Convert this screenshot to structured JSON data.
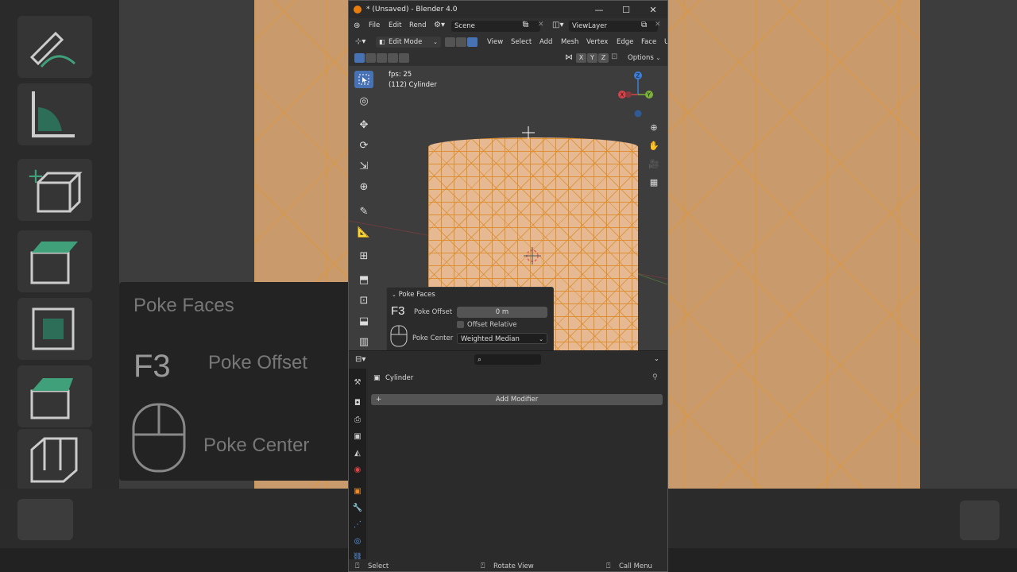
{
  "window": {
    "title": "* (Unsaved) - Blender 4.0",
    "controls": {
      "minimize": "—",
      "maximize": "☐",
      "close": "✕"
    }
  },
  "menubar": {
    "items": [
      "File",
      "Edit",
      "Rend"
    ],
    "scene": "Scene",
    "view_layer": "ViewLayer"
  },
  "viewport_header": {
    "mode": "Edit Mode",
    "menus": [
      "View",
      "Select",
      "Add",
      "Mesh",
      "Vertex",
      "Edge",
      "Face",
      "U"
    ],
    "axes": [
      "X",
      "Y",
      "Z"
    ],
    "options": "Options"
  },
  "viewport": {
    "fps": "fps: 25",
    "object": "(112) Cylinder",
    "gizmo": {
      "x": "X",
      "y": "Y",
      "z": "Z"
    }
  },
  "operator_panel": {
    "title": "Poke Faces",
    "hotkey": "F3",
    "offset_label": "Poke Offset",
    "offset_value": "0 m",
    "relative_label": "Offset Relative",
    "center_label": "Poke Center",
    "center_value": "Weighted Median"
  },
  "properties": {
    "object_name": "Cylinder",
    "add_modifier": "Add Modifier",
    "search_placeholder": ""
  },
  "statusbar": {
    "select": "Select",
    "rotate": "Rotate View",
    "call_menu": "Call Menu"
  },
  "background": {
    "panel_title": "Poke Faces",
    "hotkey": "F3",
    "offset_label": "Poke Offset",
    "center_label": "Poke Center"
  },
  "colors": {
    "accent": "#4772b3",
    "mesh_face": "#e6b993",
    "mesh_edge": "#e08c28",
    "blender_orange": "#e87d0d"
  }
}
